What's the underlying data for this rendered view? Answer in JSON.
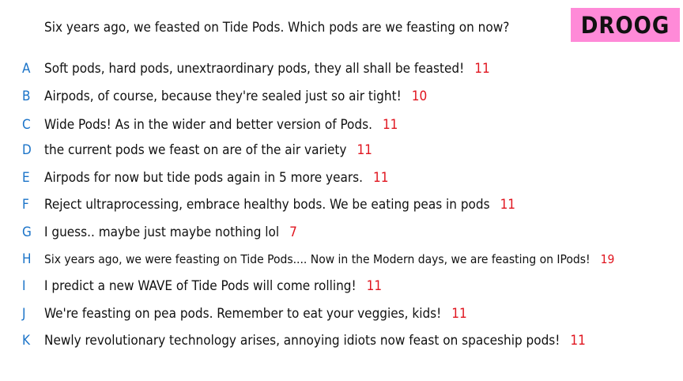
{
  "question": "Six years ago, we feasted on Tide Pods. Which pods are we feasting on now?",
  "logo_text": "DROOG",
  "colors": {
    "logo_background": "#ff8ad8",
    "letter": "#1a73c8",
    "count": "#e0141e",
    "text": "#111111"
  },
  "answers": [
    {
      "letter": "A",
      "text": "Soft pods, hard pods, unextraordinary pods, they all shall be feasted!",
      "count": "11"
    },
    {
      "letter": "B",
      "text": "Airpods, of course, because they're sealed just so air tight!",
      "count": "10"
    },
    {
      "letter": "C",
      "text": "Wide Pods! As in the wider and better version of Pods.",
      "count": "11"
    },
    {
      "letter": "D",
      "text": "the current pods we feast on are of the air variety",
      "count": "11"
    },
    {
      "letter": "E",
      "text": "Airpods for now but tide pods again in 5 more years.",
      "count": "11"
    },
    {
      "letter": "F",
      "text": "Reject ultraprocessing, embrace healthy bods. We be eating peas in pods",
      "count": "11"
    },
    {
      "letter": "G",
      "text": "I guess.. maybe just maybe nothing lol",
      "count": "7"
    },
    {
      "letter": "H",
      "text": "Six years ago, we were feasting on Tide Pods.... Now in the Modern days, we are feasting on IPods!",
      "count": "19"
    },
    {
      "letter": "I",
      "text": "I predict a new WAVE of Tide Pods will come rolling!",
      "count": "11"
    },
    {
      "letter": "J",
      "text": "We're feasting on pea pods. Remember to eat your veggies, kids!",
      "count": "11"
    },
    {
      "letter": "K",
      "text": "Newly revolutionary technology arises, annoying idiots now feast on spaceship pods!",
      "count": "11"
    }
  ]
}
